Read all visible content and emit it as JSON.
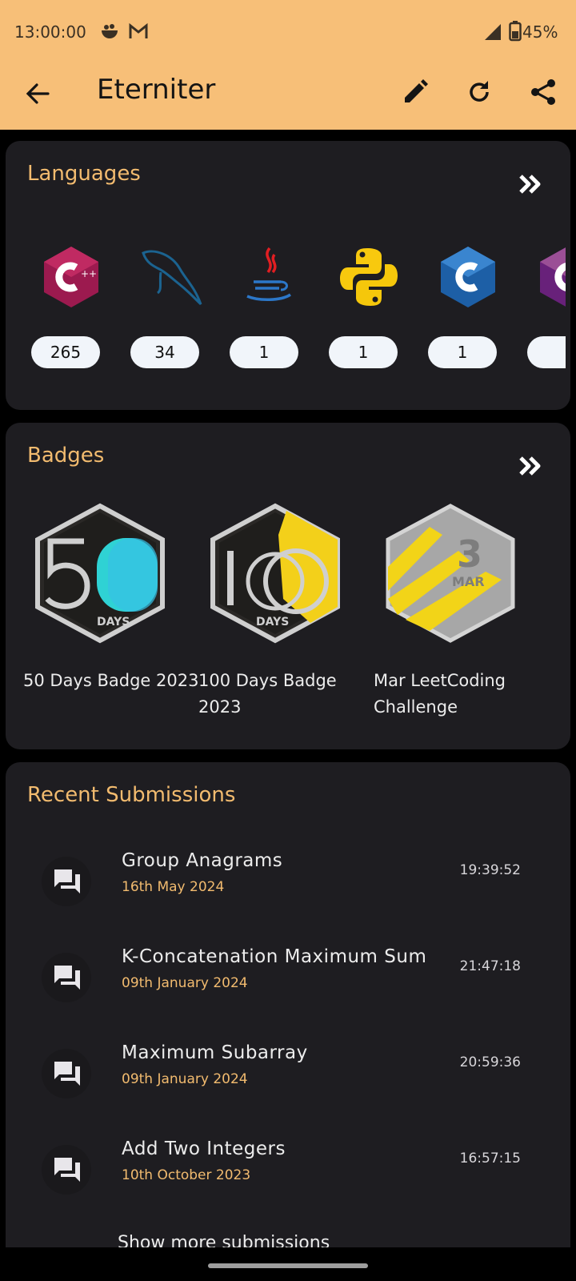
{
  "status_bar": {
    "time": "13:00:00",
    "battery": "45%"
  },
  "app_bar": {
    "title": "Eterniter"
  },
  "languages": {
    "title": "Languages",
    "items": [
      {
        "name": "C++",
        "count": "265",
        "icon": "cpp-logo-icon"
      },
      {
        "name": "MySQL",
        "count": "34",
        "icon": "mysql-logo-icon"
      },
      {
        "name": "Java",
        "count": "1",
        "icon": "java-logo-icon"
      },
      {
        "name": "Python",
        "count": "1",
        "icon": "python-logo-icon"
      },
      {
        "name": "C",
        "count": "1",
        "icon": "c-logo-icon"
      },
      {
        "name": "C#",
        "count": "",
        "icon": "csharp-logo-icon"
      }
    ]
  },
  "badges": {
    "title": "Badges",
    "items": [
      {
        "name": "50 Days Badge 2023",
        "icon": "50-days-badge-icon"
      },
      {
        "name": "100 Days Badge 2023",
        "icon": "100-days-badge-icon"
      },
      {
        "name": "Mar LeetCoding Challenge",
        "icon": "mar-challenge-badge-icon"
      }
    ],
    "badge_text": {
      "days": "DAYS",
      "mar_num": "3",
      "mar": "MAR"
    }
  },
  "recent": {
    "title": "Recent Submissions",
    "items": [
      {
        "title": "Group Anagrams",
        "date": "16th May 2024",
        "time": "19:39:52"
      },
      {
        "title": "K-Concatenation Maximum Sum",
        "date": "09th January 2024",
        "time": "21:47:18"
      },
      {
        "title": "Maximum Subarray",
        "date": "09th January 2024",
        "time": "20:59:36"
      },
      {
        "title": "Add Two Integers",
        "date": "10th October 2023",
        "time": "16:57:15"
      }
    ],
    "show_more": "Show more submissions"
  },
  "colors": {
    "accent": "#f7bf78",
    "card": "#1e1d21",
    "title": "#f2bb6f"
  }
}
